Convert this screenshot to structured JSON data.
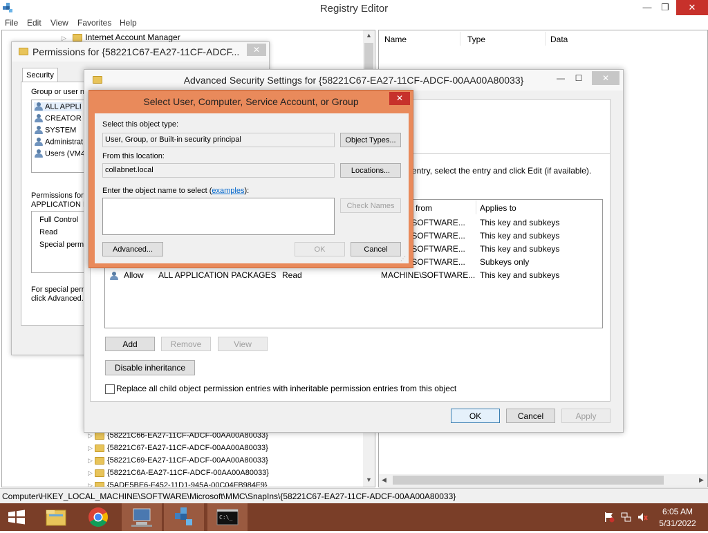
{
  "registry_editor": {
    "title": "Registry Editor",
    "menu": [
      "File",
      "Edit",
      "View",
      "Favorites",
      "Help"
    ],
    "tree_top_item": "Internet Account Manager",
    "tree_bottom_items": [
      "{58221C66-EA27-11CF-ADCF-00AA00A80033}",
      "{58221C67-EA27-11CF-ADCF-00AA00A80033}",
      "{58221C69-EA27-11CF-ADCF-00AA00A80033}",
      "{58221C6A-EA27-11CF-ADCF-00AA00A80033}",
      "{5ADE5BE6-F452-11D1-945A-00C04FB984F9}"
    ],
    "columns": [
      "Name",
      "Type",
      "Data"
    ],
    "status_path": "Computer\\HKEY_LOCAL_MACHINE\\SOFTWARE\\Microsoft\\MMC\\SnapIns\\{58221C67-EA27-11CF-ADCF-00AA00A80033}"
  },
  "permissions": {
    "title": "Permissions for {58221C67-EA27-11CF-ADCF...",
    "tab": "Security",
    "group_label": "Group or user na",
    "users": [
      "ALL APPLI",
      "CREATOR",
      "SYSTEM",
      "Administrat",
      "Users (VM4"
    ],
    "perm_label_1": "Permissions for A",
    "perm_label_2": "APPLICATION P",
    "perms": [
      "Full Control",
      "Read",
      "Special permi"
    ],
    "special_1": "For special perm",
    "special_2": "click Advanced."
  },
  "advanced": {
    "title": "Advanced Security Settings for {58221C67-EA27-11CF-ADCF-00AA00A80033}",
    "instruction": "entry, select the entry and click Edit (if available).",
    "col_from": "from",
    "col_applies": "Applies to",
    "rows": [
      {
        "type": "",
        "principal": "",
        "access": "",
        "from": "\\SOFTWARE...",
        "applies": "This key and subkeys"
      },
      {
        "type": "",
        "principal": "",
        "access": "",
        "from": "\\SOFTWARE...",
        "applies": "This key and subkeys"
      },
      {
        "type": "",
        "principal": "",
        "access": "",
        "from": "\\SOFTWARE...",
        "applies": "This key and subkeys"
      },
      {
        "type": "",
        "principal": "",
        "access": "",
        "from": "\\SOFTWARE...",
        "applies": "Subkeys only"
      },
      {
        "type": "Allow",
        "principal": "ALL APPLICATION PACKAGES",
        "access": "Read",
        "from": "MACHINE\\SOFTWARE...",
        "applies": "This key and subkeys"
      }
    ],
    "add": "Add",
    "remove": "Remove",
    "view": "View",
    "disable_inheritance": "Disable inheritance",
    "replace_label": "Replace all child object permission entries with inheritable permission entries from this object",
    "ok": "OK",
    "cancel": "Cancel",
    "apply": "Apply"
  },
  "select_dialog": {
    "title": "Select User, Computer, Service Account, or Group",
    "object_type_label": "Select this object type:",
    "object_type_value": "User, Group, or Built-in security principal",
    "object_types_btn": "Object Types...",
    "location_label": "From this location:",
    "location_value": "collabnet.local",
    "locations_btn": "Locations...",
    "name_label_prefix": "Enter the object name to select (",
    "name_label_link": "examples",
    "name_label_suffix": "):",
    "check_names": "Check Names",
    "advanced_btn": "Advanced...",
    "ok": "OK",
    "cancel": "Cancel"
  },
  "taskbar": {
    "time": "6:05 AM",
    "date": "5/31/2022"
  }
}
